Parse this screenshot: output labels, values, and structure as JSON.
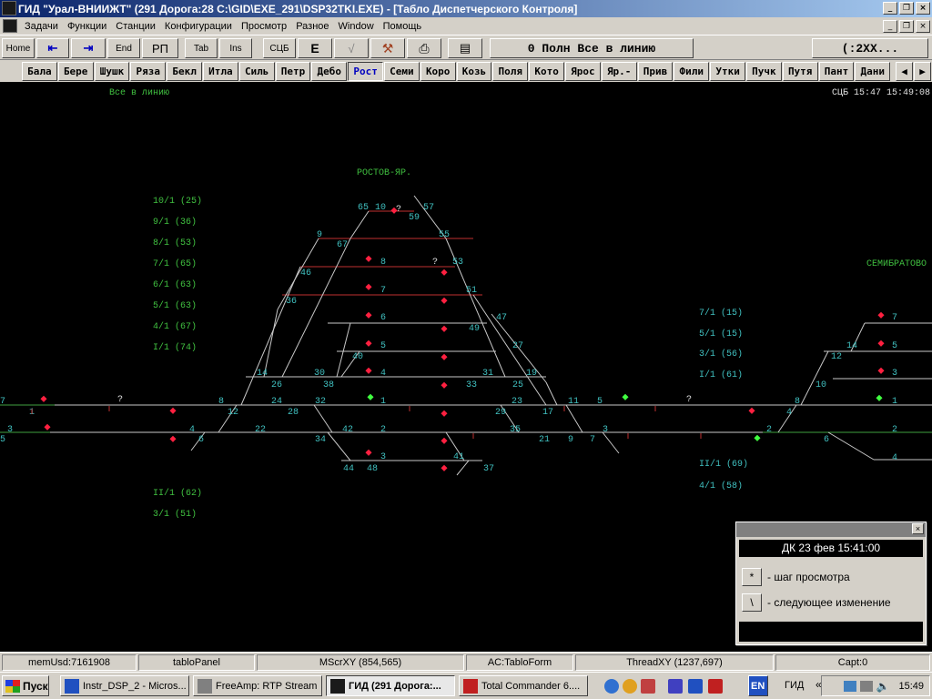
{
  "window": {
    "title": "ГИД \"Урал-ВНИИЖТ\" (291 Дорога:28 C:\\GID\\EXE_291\\DSP32TKI.EXE) - [Табло Диспетчерского Контроля]"
  },
  "menu": [
    "Задачи",
    "Функции",
    "Станции",
    "Конфигурации",
    "Просмотр",
    "Разное",
    "Window",
    "Помощь"
  ],
  "toolbar": {
    "home": "Home",
    "prev": "⇤",
    "next": "⇥",
    "end": "End",
    "rp": "РП",
    "tab": "Tab",
    "ins": "Ins",
    "scb": "СЦБ",
    "e": "E",
    "check": "√",
    "status": "0 Полн Все в линию",
    "mode": "(:2XX..."
  },
  "stations": [
    "Бала",
    "Бере",
    "Шушк",
    "Ряза",
    "Бекл",
    "Итла",
    "Силь",
    "Петр",
    "Дебо",
    "Рост",
    "Семи",
    "Коро",
    "Козь",
    "Поля",
    "Кото",
    "Ярос",
    "Яр.-",
    "Прив",
    "Фили",
    "Утки",
    "Пучк",
    "Путя",
    "Пант",
    "Дани"
  ],
  "active_station": "Рост",
  "scheme": {
    "mode_label": "Все в линию",
    "clock": "СЦБ 15:47 15:49:08",
    "station_rostov": "РОСТОВ-ЯР.",
    "station_semibratovo": "СЕМИБРАТОВО",
    "track_labels_left": [
      "10/1 (25)",
      "9/1 (36)",
      "8/1 (53)",
      "7/1 (65)",
      "6/1 (63)",
      "5/1 (63)",
      "4/1 (67)",
      "I/1 (74)",
      "II/1 (62)",
      "3/1 (51)"
    ],
    "track_labels_right": [
      "7/1 (15)",
      "5/1 (15)",
      "3/1 (56)",
      "I/1 (61)",
      "II/1 (69)",
      "4/1 (58)"
    ]
  },
  "popup": {
    "date": "ДК 23 фев 15:41:00",
    "key1": "*",
    "label1": "- шаг просмотра",
    "key2": "\\",
    "label2": "- следующее изменение"
  },
  "statusbar": [
    "memUsd:7161908",
    "tabloPanel",
    "MScrXY (854,565)",
    "AC:TabloForm",
    "ThreadXY (1237,697)",
    "Capt:0"
  ],
  "taskbar": {
    "start": "Пуск",
    "tasks": [
      "Instr_DSP_2 - Micros...",
      "FreeAmp: RTP Stream",
      "ГИД (291 Дорога:...",
      "Total Commander 6...."
    ],
    "lang": "EN",
    "tray_label": "ГИД",
    "time": "15:49"
  },
  "colors": {
    "track": "#c8c8c8",
    "green_text": "#40c040",
    "cyan_text": "#40c0c0",
    "signal_red": "#ff2040",
    "signal_green": "#40ff40"
  }
}
